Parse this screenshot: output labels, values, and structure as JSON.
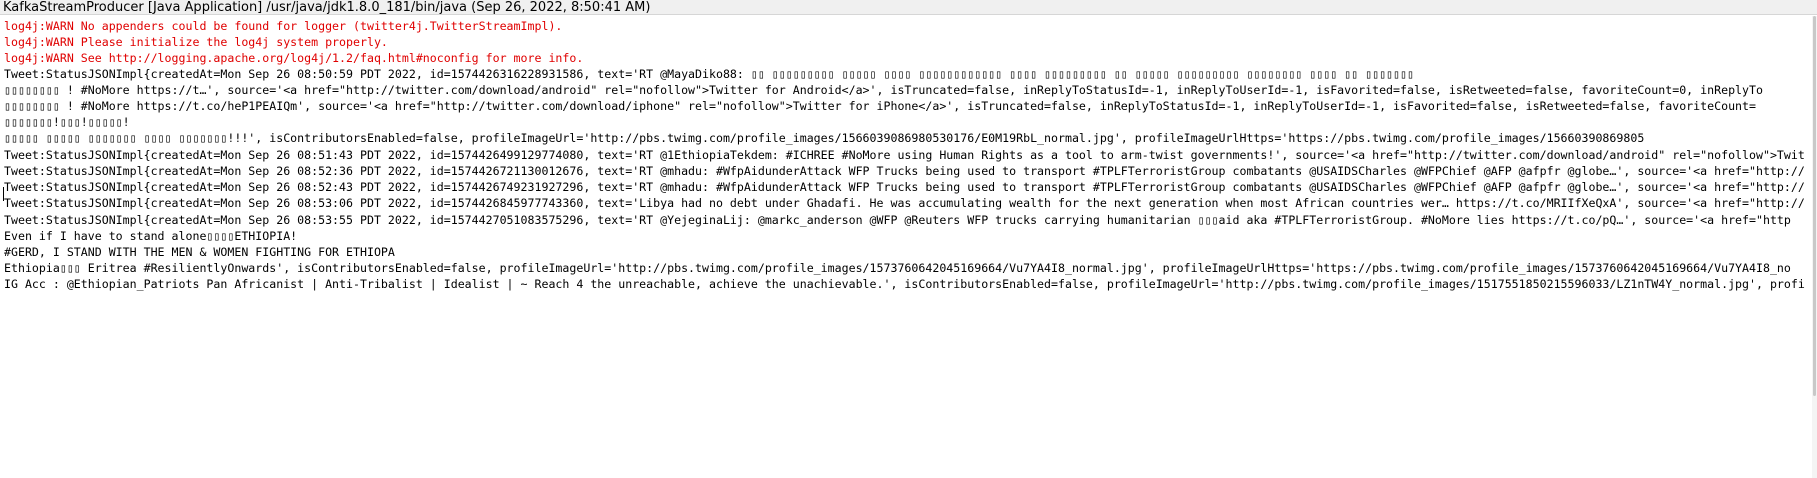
{
  "window": {
    "title": "KafkaStreamProducer [Java Application] /usr/java/jdk1.8.0_181/bin/java (Sep 26, 2022, 8:50:41 AM)"
  },
  "colors": {
    "error_text": "#e00000",
    "stdout_text": "#000000",
    "background": "#ffffff"
  },
  "console": {
    "lines": [
      "log4j:WARN No appenders could be found for logger (twitter4j.TwitterStreamImpl).",
      "log4j:WARN Please initialize the log4j system properly.",
      "log4j:WARN See http://logging.apache.org/log4j/1.2/faq.html#noconfig for more info.",
      "Tweet:StatusJSONImpl{createdAt=Mon Sep 26 08:50:59 PDT 2022, id=1574426316228931586, text='RT @MayaDiko88: ▯▯ ▯▯▯▯▯▯▯▯▯ ▯▯▯▯▯ ▯▯▯▯ ▯▯▯▯▯▯▯▯▯▯▯▯ ▯▯▯▯ ▯▯▯▯▯▯▯▯▯ ▯▯ ▯▯▯▯▯ ▯▯▯▯▯▯▯▯▯ ▯▯▯▯▯▯▯▯ ▯▯▯▯ ▯▯ ▯▯▯▯▯▯▯",
      "▯▯▯▯▯▯▯▯ ! #NoMore https://t…', source='<a href=\"http://twitter.com/download/android\" rel=\"nofollow\">Twitter for Android</a>', isTruncated=false, inReplyToStatusId=-1, inReplyToUserId=-1, isFavorited=false, isRetweeted=false, favoriteCount=0, inReplyTo",
      "▯▯▯▯▯▯▯▯ ! #NoMore https://t.co/heP1PEAIQm', source='<a href=\"http://twitter.com/download/iphone\" rel=\"nofollow\">Twitter for iPhone</a>', isTruncated=false, inReplyToStatusId=-1, inReplyToUserId=-1, isFavorited=false, isRetweeted=false, favoriteCount=",
      "▯▯▯▯▯▯▯!▯▯▯!▯▯▯▯▯!",
      "▯▯▯▯▯ ▯▯▯▯▯ ▯▯▯▯▯▯▯ ▯▯▯▯ ▯▯▯▯▯▯▯!!!', isContributorsEnabled=false, profileImageUrl='http://pbs.twimg.com/profile_images/1566039086980530176/E0M19RbL_normal.jpg', profileImageUrlHttps='https://pbs.twimg.com/profile_images/15660390869805",
      "Tweet:StatusJSONImpl{createdAt=Mon Sep 26 08:51:43 PDT 2022, id=1574426499129774080, text='RT @1EthiopiaTekdem: #ICHREE #NoMore using Human Rights as a tool to arm-twist governments!', source='<a href=\"http://twitter.com/download/android\" rel=\"nofollow\">Twit",
      "Tweet:StatusJSONImpl{createdAt=Mon Sep 26 08:52:36 PDT 2022, id=1574426721130012676, text='RT @mhadu: #WfpAidunderAttack WFP Trucks being used to transport #TPLFTerroristGroup combatants @USAIDSCharles @WFPChief @AFP @afpfr @globe…', source='<a href=\"http://",
      "Tweet:StatusJSONImpl{createdAt=Mon Sep 26 08:52:43 PDT 2022, id=1574426749231927296, text='RT @mhadu: #WfpAidunderAttack WFP Trucks being used to transport #TPLFTerroristGroup combatants @USAIDSCharles @WFPChief @AFP @afpfr @globe…', source='<a href=\"http://",
      "Tweet:StatusJSONImpl{createdAt=Mon Sep 26 08:53:06 PDT 2022, id=1574426845977743360, text='Libya had no debt under Ghadafi. He was accumulating wealth for the next generation when most African countries wer… https://t.co/MRIIfXeQxA', source='<a href=\"http://",
      "Tweet:StatusJSONImpl{createdAt=Mon Sep 26 08:53:55 PDT 2022, id=1574427051083575296, text='RT @YejeginaLij: @markc_anderson @WFP @Reuters WFP trucks carrying humanitarian ▯▯▯aid aka #TPLFTerroristGroup. #NoMore lies https://t.co/pQ…', source='<a href=\"http",
      "Even if I have to stand alone▯▯▯▯ETHIOPIA!",
      "#GERD, I STAND WITH THE MEN & WOMEN FIGHTING FOR ETHIOPA",
      "Ethiopia▯▯▯ Eritrea #ResilientlyOnwards', isContributorsEnabled=false, profileImageUrl='http://pbs.twimg.com/profile_images/1573760642045169664/Vu7YA4I8_normal.jpg', profileImageUrlHttps='https://pbs.twimg.com/profile_images/1573760642045169664/Vu7YA4I8_no",
      "IG Acc : @Ethiopian_Patriots Pan Africanist | Anti-Tribalist | Idealist | ~ Reach 4 the unreachable, achieve the unachievable.', isContributorsEnabled=false, profileImageUrl='http://pbs.twimg.com/profile_images/1517551850215596033/LZ1nTW4Y_normal.jpg', profi"
    ]
  }
}
